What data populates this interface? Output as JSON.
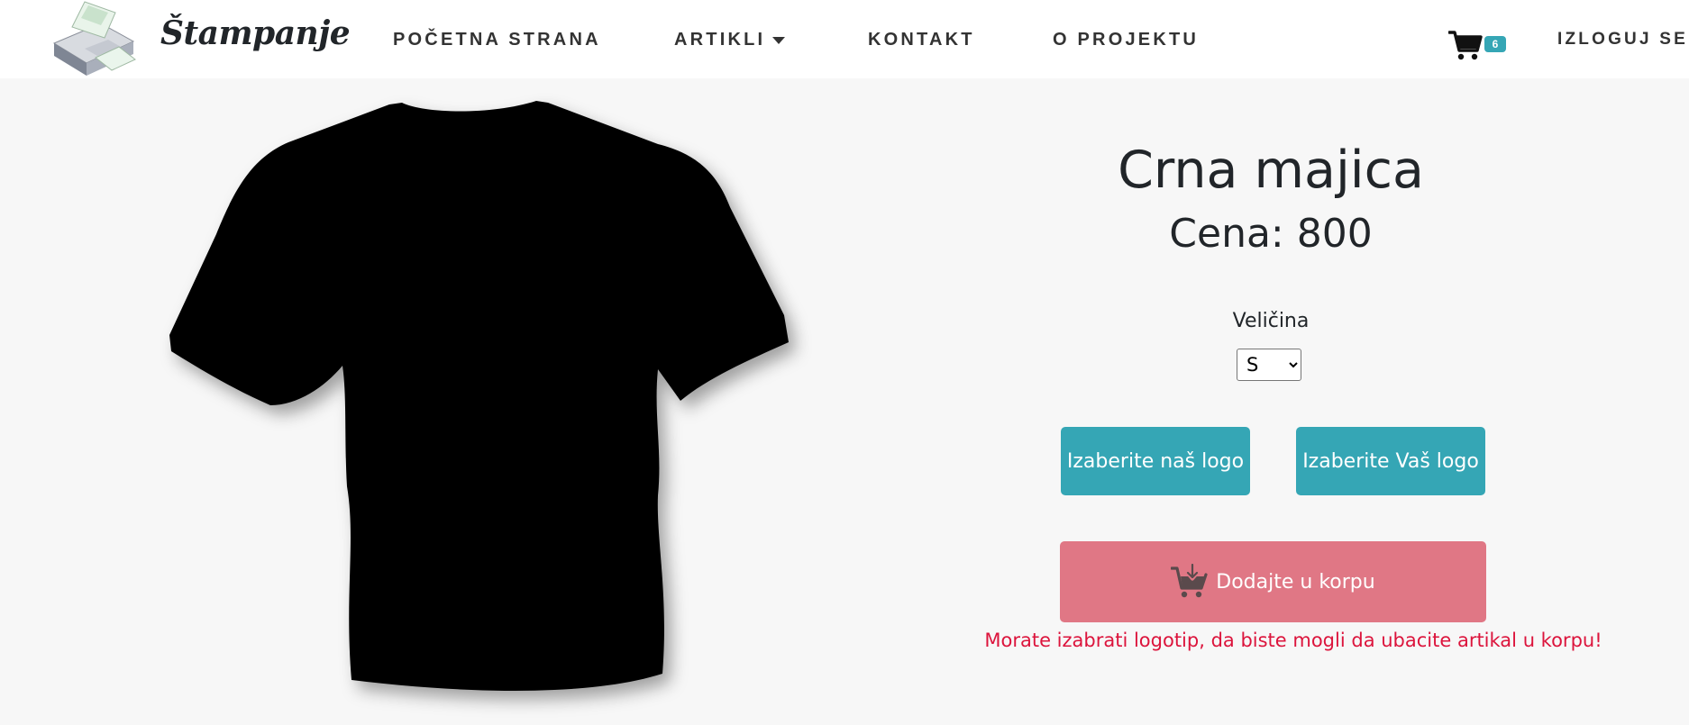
{
  "navbar": {
    "brand": "Štampanje",
    "logo_icon": "printer-icon",
    "links": [
      {
        "label": "POČETNA STRANA"
      },
      {
        "label": "ARTIKLI"
      },
      {
        "label": "KONTAKT"
      },
      {
        "label": "O PROJEKTU"
      }
    ],
    "artikli_dropdown_icon": "caret-down-icon",
    "cart_icon": "shopping-cart-icon",
    "cart_count": "6",
    "logout": "IZLOGUJ SE"
  },
  "product": {
    "image_icon": "t-shirt-image",
    "title": "Crna majica",
    "price_label": "Cena: 800",
    "size_label": "Veličina",
    "size_selected": "S",
    "size_options": [
      "S"
    ],
    "choose_our_logo": "Izaberite naš logo",
    "choose_your_logo": "Izaberite Vaš logo",
    "add_to_cart": "Dodajte u korpu",
    "add_to_cart_icon": "cart-download-icon",
    "warning": "Morate izabrati logotip, da biste mogli da ubacite artikal u korpu!"
  },
  "colors": {
    "accent": "#35a6b5",
    "cart_button": "#e07785",
    "warning": "#dc143c",
    "background": "#f7f7f7"
  }
}
